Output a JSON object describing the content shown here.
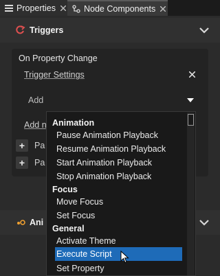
{
  "tabs": [
    {
      "label": "Properties",
      "active": false
    },
    {
      "label": "Node Components",
      "active": true
    }
  ],
  "triggers_section": {
    "title": "Triggers",
    "card_title": "On Property Change",
    "trigger_settings": "Trigger Settings",
    "add_label": "Add",
    "add_next_partial": "Add ne",
    "collapsed_rows": [
      "Pa",
      "Pa"
    ]
  },
  "animation_section": {
    "title_partial": "Ani"
  },
  "dropdown": {
    "groups": [
      {
        "label": "Animation",
        "items": [
          "Pause Animation Playback",
          "Resume Animation Playback",
          "Start Animation Playback",
          "Stop Animation Playback"
        ]
      },
      {
        "label": "Focus",
        "items": [
          "Move Focus",
          "Set Focus"
        ]
      },
      {
        "label": "General",
        "items": [
          "Activate Theme",
          "Execute Script",
          "Set Property"
        ]
      }
    ],
    "selected": "Execute Script"
  },
  "colors": {
    "selection": "#1e6bb8",
    "trigger_icon": "#e05050",
    "anim_icon": "#f0a030"
  }
}
